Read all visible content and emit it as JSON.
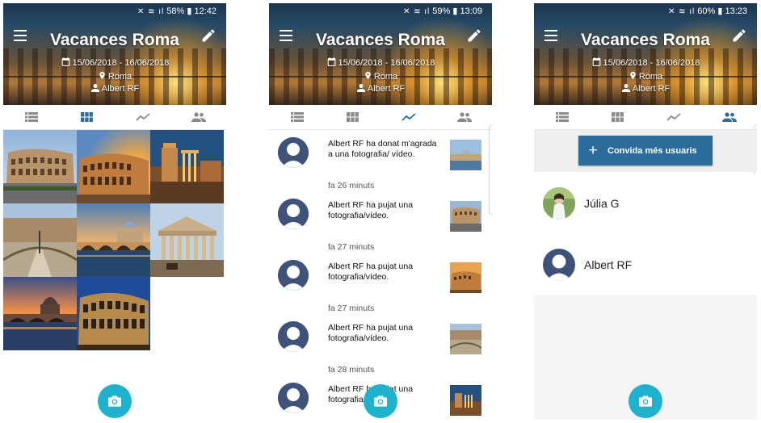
{
  "colors": {
    "tab_active": "#2d6b9a",
    "tab_inactive": "#8a8a8a",
    "fab": "#1fb2cf",
    "button": "#2d6b9a"
  },
  "screens": [
    {
      "status": {
        "battery": "58%",
        "time": "12:42"
      },
      "title": "Vacances Roma",
      "dates": "15/06/2018 - 16/06/2018",
      "place": "Roma",
      "owner": "Albert RF",
      "active_tab": "photos"
    },
    {
      "status": {
        "battery": "59%",
        "time": "13:09"
      },
      "title": "Vacances Roma",
      "dates": "15/06/2018 - 16/06/2018",
      "place": "Roma",
      "owner": "Albert RF",
      "active_tab": "activity"
    },
    {
      "status": {
        "battery": "60%",
        "time": "13:23"
      },
      "title": "Vacances Roma",
      "dates": "15/06/2018 - 16/06/2018",
      "place": "Roma",
      "owner": "Albert RF",
      "active_tab": "members"
    }
  ],
  "tabs": [
    {
      "name": "list",
      "icon": "list-icon"
    },
    {
      "name": "photos",
      "icon": "grid-icon"
    },
    {
      "name": "activity",
      "icon": "trending-icon"
    },
    {
      "name": "members",
      "icon": "people-icon"
    }
  ],
  "photos": [
    {
      "icon": "colosseum-photo"
    },
    {
      "icon": "colosseum-sunset-photo"
    },
    {
      "icon": "forum-night-photo"
    },
    {
      "icon": "st-peters-square-photo"
    },
    {
      "icon": "tiber-bridge-photo"
    },
    {
      "icon": "pantheon-photo"
    },
    {
      "icon": "vatican-sunset-photo"
    },
    {
      "icon": "colosseum-night-photo"
    }
  ],
  "activity": [
    {
      "text": "Albert RF ha donat m'agrada a una fotografia/ vídeo.",
      "time": "fa 26 minuts"
    },
    {
      "text": "Albert RF ha pujat una fotografia/vídeo.",
      "time": "fa 27 minuts"
    },
    {
      "text": "Albert RF ha pujat una fotografia/vídeo.",
      "time": "fa 27 minuts"
    },
    {
      "text": "Albert RF ha pujat una fotografia/vídeo.",
      "time": "fa 28 minuts"
    },
    {
      "text": "Albert RF ha pujat una fotografia/vídeo.",
      "time": ""
    }
  ],
  "invite": {
    "label": "Convida més usuaris"
  },
  "members": [
    {
      "name": "Júlia G"
    },
    {
      "name": "Albert RF"
    }
  ]
}
